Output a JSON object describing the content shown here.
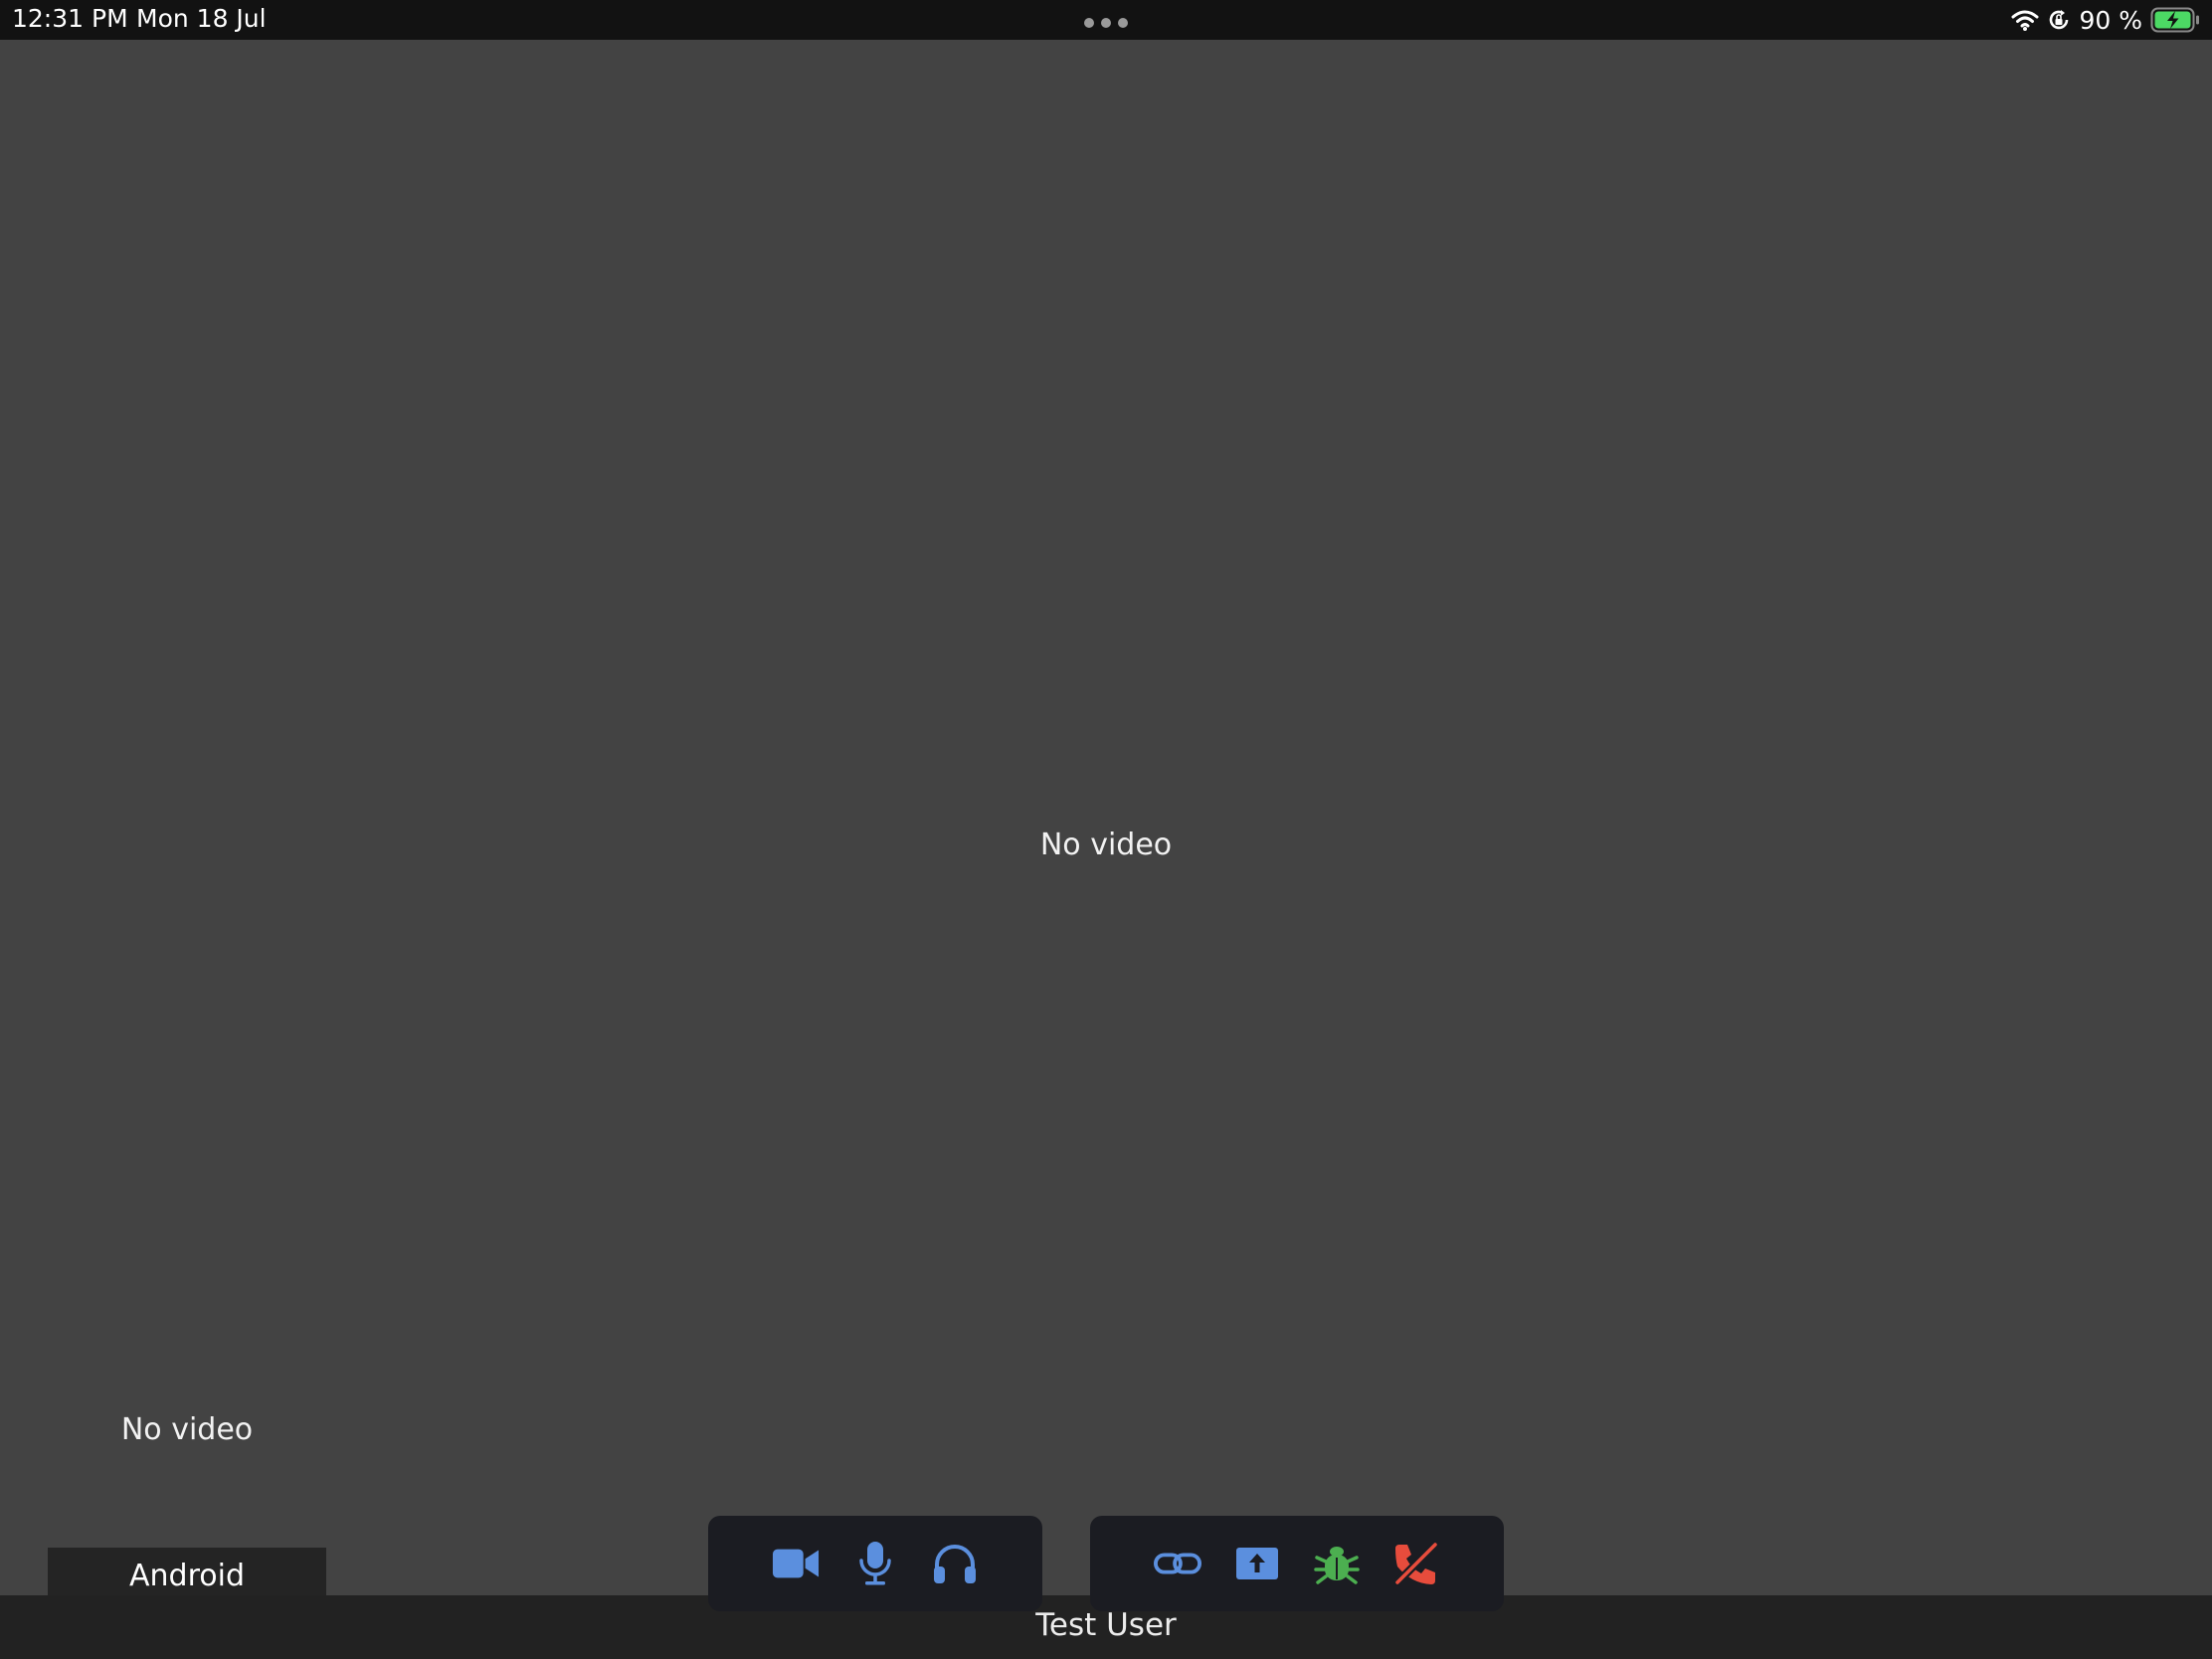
{
  "status_bar": {
    "time": "12:31 PM",
    "date": "Mon 18 Jul",
    "battery_percent": "90 %",
    "icons": [
      "wifi-icon",
      "orientation-lock-icon",
      "battery-charging-icon"
    ]
  },
  "main_video": {
    "no_video_text": "No video"
  },
  "pip_video": {
    "no_video_text": "No video",
    "participant_label": "Android"
  },
  "toolbar_left": {
    "buttons": [
      {
        "name": "camera",
        "icon": "video-camera-icon",
        "color": "#5b8fde"
      },
      {
        "name": "microphone",
        "icon": "microphone-icon",
        "color": "#5b8fde"
      },
      {
        "name": "audio-output",
        "icon": "headphones-icon",
        "color": "#5b8fde"
      }
    ]
  },
  "toolbar_right": {
    "buttons": [
      {
        "name": "copy-link",
        "icon": "link-icon",
        "color": "#5b8fde"
      },
      {
        "name": "share-screen",
        "icon": "share-upload-icon",
        "color": "#5b8fde"
      },
      {
        "name": "debug",
        "icon": "bug-icon",
        "color": "#4caf50"
      },
      {
        "name": "end-call",
        "icon": "hang-up-phone-icon",
        "color": "#e74c3c"
      }
    ]
  },
  "local_user": {
    "name": "Test User"
  },
  "colors": {
    "background": "#434343",
    "status_bar": "#121212",
    "toolbar": "#1b1c22",
    "accent_blue": "#5b8fde",
    "accent_green": "#4caf50",
    "accent_red": "#e74c3c"
  }
}
